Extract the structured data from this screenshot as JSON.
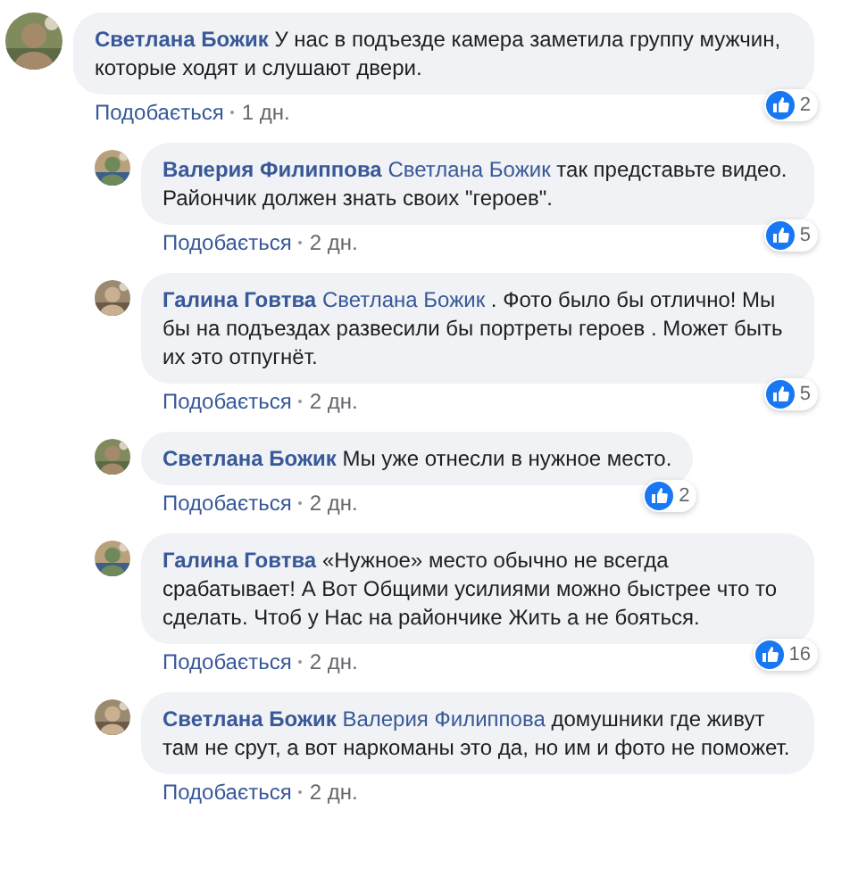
{
  "comments": [
    {
      "author": "Светлана Божик",
      "text": "У нас в подъезде камера заметила группу мужчин, которые ходят и слушают двери.",
      "likes": "2",
      "like_label": "Подобається",
      "time": "1 дн.",
      "replies": [
        {
          "author": "Валерия Филиппова",
          "mention": "Светлана Божик",
          "text": "так представьте видео. Райончик должен знать своих \"героев\".",
          "likes": "5",
          "like_label": "Подобається",
          "time": "2 дн."
        },
        {
          "author": "Галина Говтва",
          "mention": "Светлана Божик",
          "text": ". Фото было бы отлично! Мы бы на подъездах развесили бы портреты героев . Может быть их это отпугнёт.",
          "likes": "5",
          "like_label": "Подобається",
          "time": "2 дн."
        },
        {
          "author": "Светлана Божик",
          "text": "Мы уже отнесли в нужное место.",
          "likes": "2",
          "like_label": "Подобається",
          "time": "2 дн."
        },
        {
          "author": "Галина Говтва",
          "text": "«Нужное» место обычно не всегда срабатывает! А Вот Общими усилиями можно быстрее что то сделать. Чтоб у Нас на райончике Жить а не бояться.",
          "likes": "16",
          "like_label": "Подобається",
          "time": "2 дн."
        },
        {
          "author": "Светлана Божик",
          "mention": "Валерия Филиппова",
          "text": "домушники где живут там не срут, а вот наркоманы это да, но им и фото не поможет.",
          "like_label": "Подобається",
          "time": "2 дн."
        }
      ]
    }
  ]
}
